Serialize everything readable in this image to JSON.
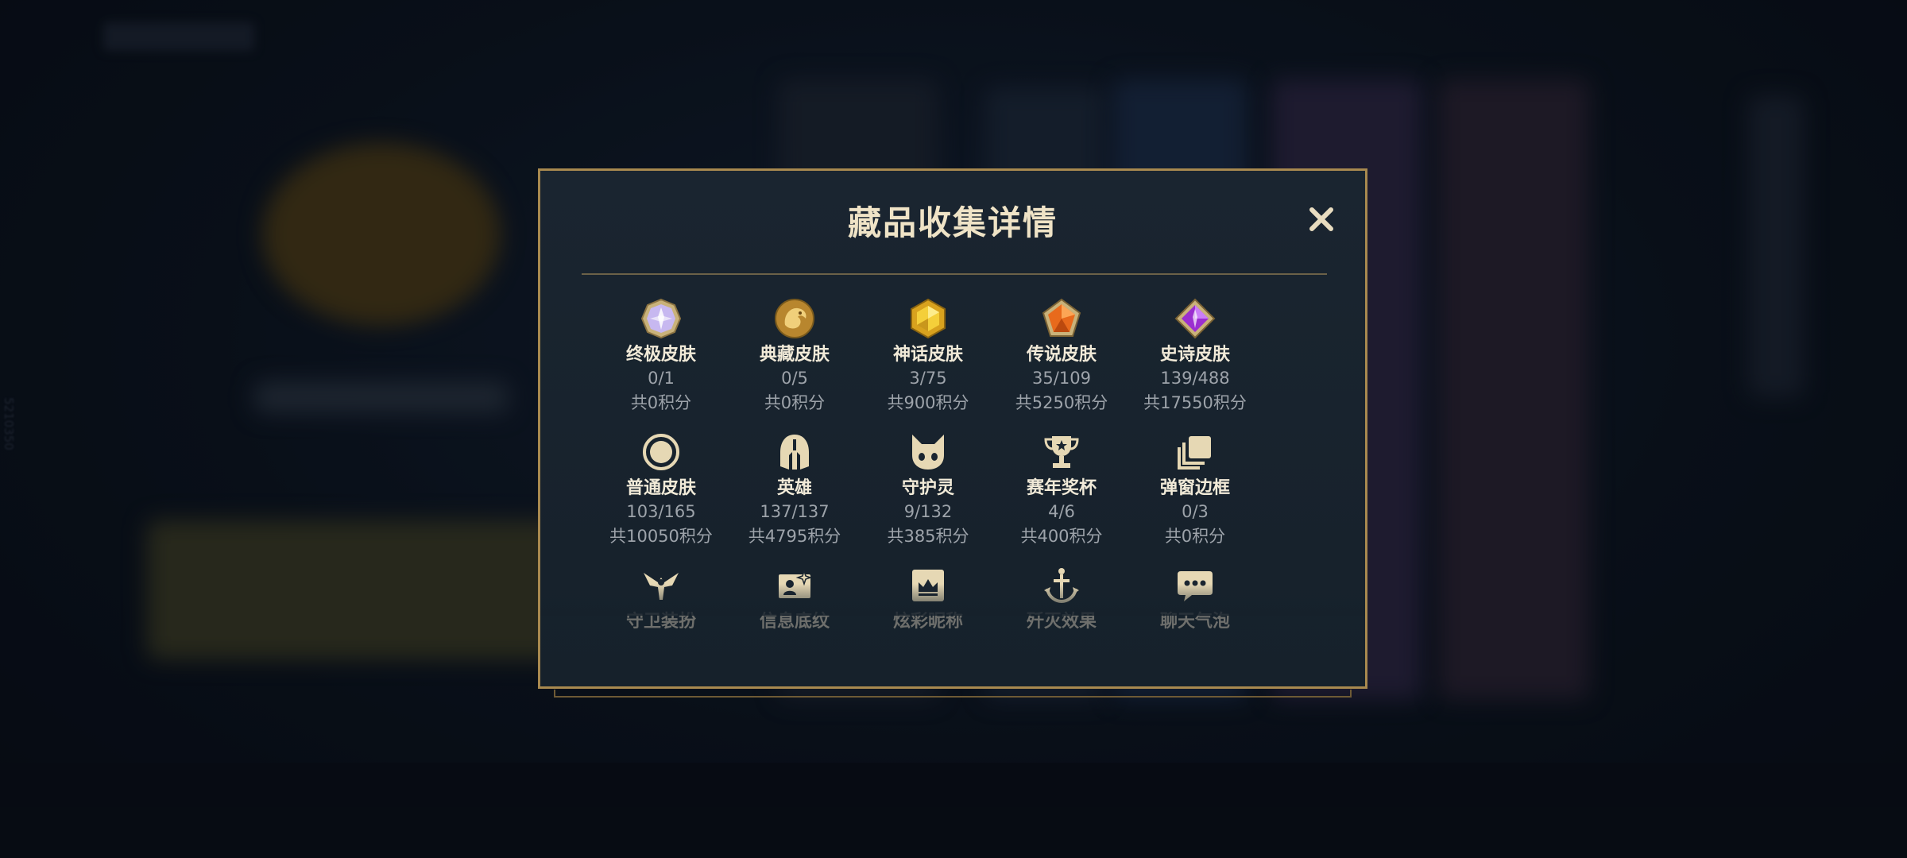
{
  "background": {
    "side_number": "5210350"
  },
  "dialog": {
    "title": "藏品收集详情",
    "close_label": "✕"
  },
  "categories": [
    {
      "name": "终极皮肤",
      "progress": "0/1",
      "points": "共0积分",
      "icon": "ultimate-skin-icon"
    },
    {
      "name": "典藏皮肤",
      "progress": "0/5",
      "points": "共0积分",
      "icon": "collection-skin-icon"
    },
    {
      "name": "神话皮肤",
      "progress": "3/75",
      "points": "共900积分",
      "icon": "mythic-skin-icon"
    },
    {
      "name": "传说皮肤",
      "progress": "35/109",
      "points": "共5250积分",
      "icon": "legendary-skin-icon"
    },
    {
      "name": "史诗皮肤",
      "progress": "139/488",
      "points": "共17550积分",
      "icon": "epic-skin-icon"
    },
    {
      "name": "普通皮肤",
      "progress": "103/165",
      "points": "共10050积分",
      "icon": "normal-skin-icon"
    },
    {
      "name": "英雄",
      "progress": "137/137",
      "points": "共4795积分",
      "icon": "hero-helmet-icon"
    },
    {
      "name": "守护灵",
      "progress": "9/132",
      "points": "共385积分",
      "icon": "guardian-spirit-icon"
    },
    {
      "name": "赛年奖杯",
      "progress": "4/6",
      "points": "共400积分",
      "icon": "trophy-icon"
    },
    {
      "name": "弹窗边框",
      "progress": "0/3",
      "points": "共0积分",
      "icon": "popup-frame-icon"
    },
    {
      "name": "守卫装扮",
      "icon": "ward-skin-icon"
    },
    {
      "name": "信息底纹",
      "icon": "info-card-icon"
    },
    {
      "name": "炫彩昵称",
      "icon": "colorful-nickname-icon"
    },
    {
      "name": "歼灭效果",
      "icon": "annihilation-effect-icon"
    },
    {
      "name": "聊天气泡",
      "icon": "chat-bubble-icon"
    }
  ],
  "colors": {
    "gold_border": "#a8894f",
    "title_text": "#efe3c6",
    "label_text": "#f1ead8",
    "muted_text": "#9da3aa",
    "dialog_bg": "#1a2530"
  }
}
